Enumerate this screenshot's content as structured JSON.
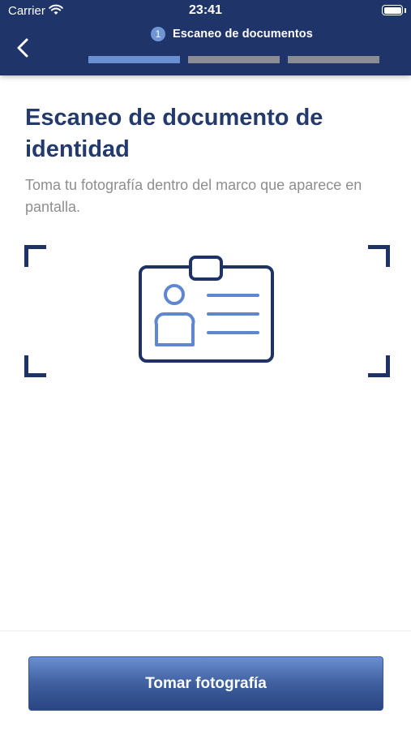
{
  "status_bar": {
    "carrier": "Carrier",
    "time": "23:41",
    "wifi_icon": "wifi-icon",
    "battery_icon": "battery-icon"
  },
  "header": {
    "back_icon": "chevron-left-icon",
    "step_number": "1",
    "step_title": "Escaneo de documentos",
    "progress_steps": [
      {
        "state": "active",
        "color": "#6a90d2"
      },
      {
        "state": "inactive",
        "color": "#8a8d93"
      },
      {
        "state": "inactive",
        "color": "#8a8d93"
      }
    ],
    "background_color": "#1f3468"
  },
  "main": {
    "title": "Escaneo de documento de identidad",
    "instructions": "Toma tu fotografía dentro del marco que aparece en pantalla.",
    "illustration_icon": "id-card-icon",
    "frame": "scan-frame-corners"
  },
  "footer": {
    "button_label": "Tomar fotografía"
  },
  "colors": {
    "accent": "#6a90d2",
    "navy": "#1f3468",
    "title": "#243a6c",
    "instructions": "#8e8e8e"
  }
}
